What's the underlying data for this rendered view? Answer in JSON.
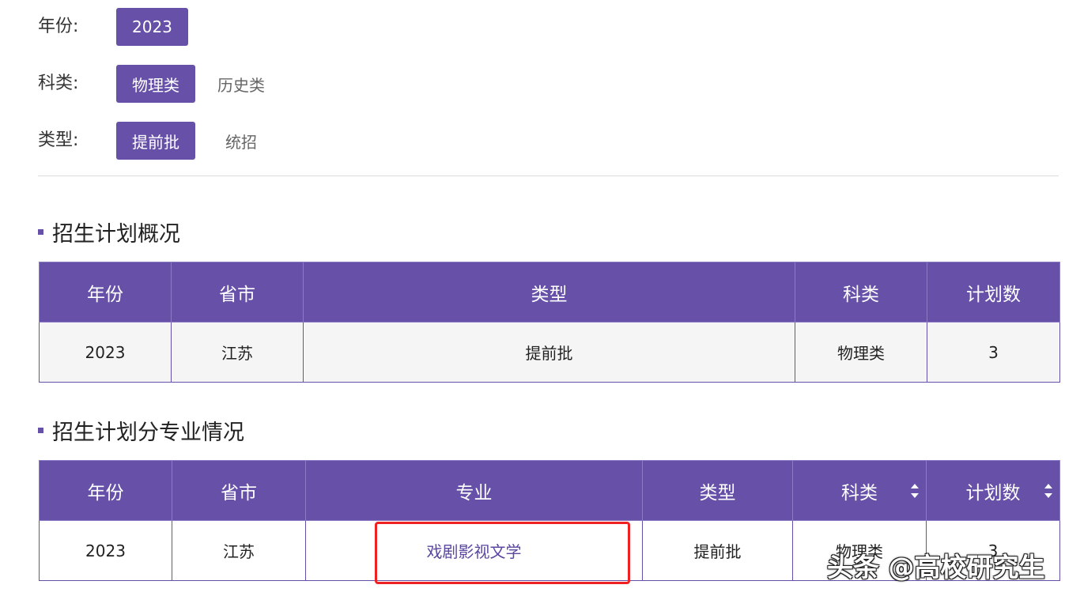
{
  "filters": {
    "year": {
      "label": "年份:",
      "options": [
        "2023"
      ]
    },
    "subject": {
      "label": "科类:",
      "options": [
        "物理类",
        "历史类"
      ]
    },
    "batch": {
      "label": "类型:",
      "options": [
        "提前批",
        "统招"
      ]
    }
  },
  "overview": {
    "title": "招生计划概况",
    "headers": [
      "年份",
      "省市",
      "类型",
      "科类",
      "计划数"
    ],
    "rows": [
      [
        "2023",
        "江苏",
        "提前批",
        "物理类",
        "3"
      ]
    ]
  },
  "by_major": {
    "title": "招生计划分专业情况",
    "headers": [
      "年份",
      "省市",
      "专业",
      "类型",
      "科类",
      "计划数"
    ],
    "rows": [
      [
        "2023",
        "江苏",
        "戏剧影视文学",
        "提前批",
        "物理类",
        "3"
      ]
    ]
  },
  "watermark": "头条 @高校研究生",
  "colors": {
    "accent": "#6650a8",
    "highlight": "#ee2222"
  }
}
